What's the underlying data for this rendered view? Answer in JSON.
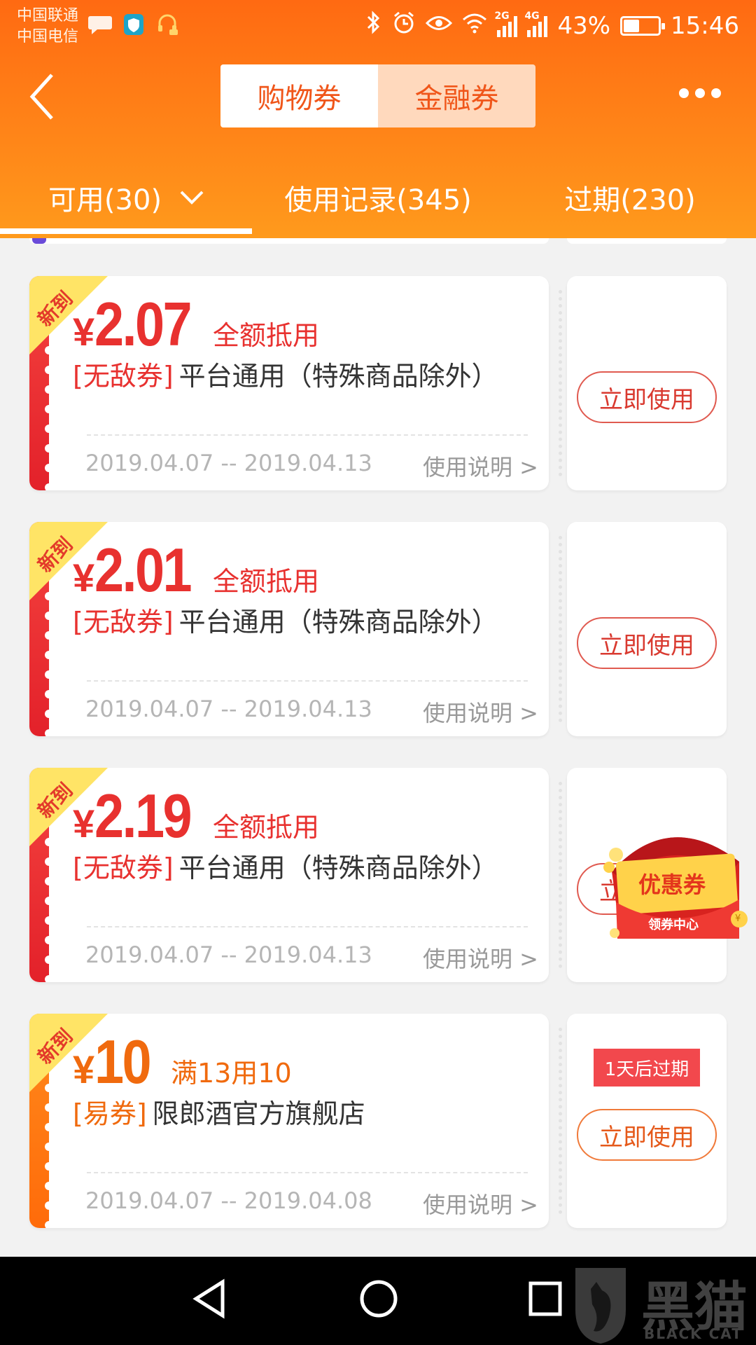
{
  "status_bar": {
    "carrier_1": "中国联通",
    "carrier_2": "中国电信",
    "network_2g": "2G",
    "network_4g": "4G",
    "battery": "43%",
    "time": "15:46"
  },
  "header": {
    "segments": [
      {
        "label": "购物券",
        "active": true
      },
      {
        "label": "金融券",
        "active": false
      }
    ],
    "tabs": [
      {
        "label": "可用(30)",
        "active": true
      },
      {
        "label": "使用记录(345)",
        "active": false
      },
      {
        "label": "过期(230)",
        "active": false
      }
    ]
  },
  "coupons": [
    {
      "badge": "新到",
      "currency": "¥",
      "amount": "2.07",
      "condition": "全额抵用",
      "tag": "[无敌券]",
      "scope": "平台通用（特殊商品除外）",
      "dates": "2019.04.07 -- 2019.04.13",
      "instructions": "使用说明 >",
      "button": "立即使用",
      "color": "#e8312f"
    },
    {
      "badge": "新到",
      "currency": "¥",
      "amount": "2.01",
      "condition": "全额抵用",
      "tag": "[无敌券]",
      "scope": "平台通用（特殊商品除外）",
      "dates": "2019.04.07 -- 2019.04.13",
      "instructions": "使用说明 >",
      "button": "立即使用",
      "color": "#e8312f"
    },
    {
      "badge": "新到",
      "currency": "¥",
      "amount": "2.19",
      "condition": "全额抵用",
      "tag": "[无敌券]",
      "scope": "平台通用（特殊商品除外）",
      "dates": "2019.04.07 -- 2019.04.13",
      "instructions": "使用说明 >",
      "button": "立即使用",
      "color": "#e8312f"
    },
    {
      "badge": "新到",
      "currency": "¥",
      "amount": "10",
      "condition": "满13用10",
      "tag": "[易券]",
      "scope": "限郎酒官方旗舰店",
      "dates": "2019.04.07 -- 2019.04.08",
      "instructions": "使用说明 >",
      "button": "立即使用",
      "expiry": "1天后过期",
      "color": "#f06a0e"
    }
  ],
  "floating_promo": {
    "title": "优惠券",
    "subtitle": "领券中心",
    "coin_symbol": "¥"
  },
  "watermark": {
    "text_cn": "黑猫",
    "text_en": "BLACK CAT"
  },
  "colors": {
    "header_top": "#ff6a12",
    "header_bottom": "#ff9a1c",
    "coupon_red": "#e8312f",
    "coupon_orange": "#f06a0e",
    "page_bg": "#f2f2f2"
  }
}
